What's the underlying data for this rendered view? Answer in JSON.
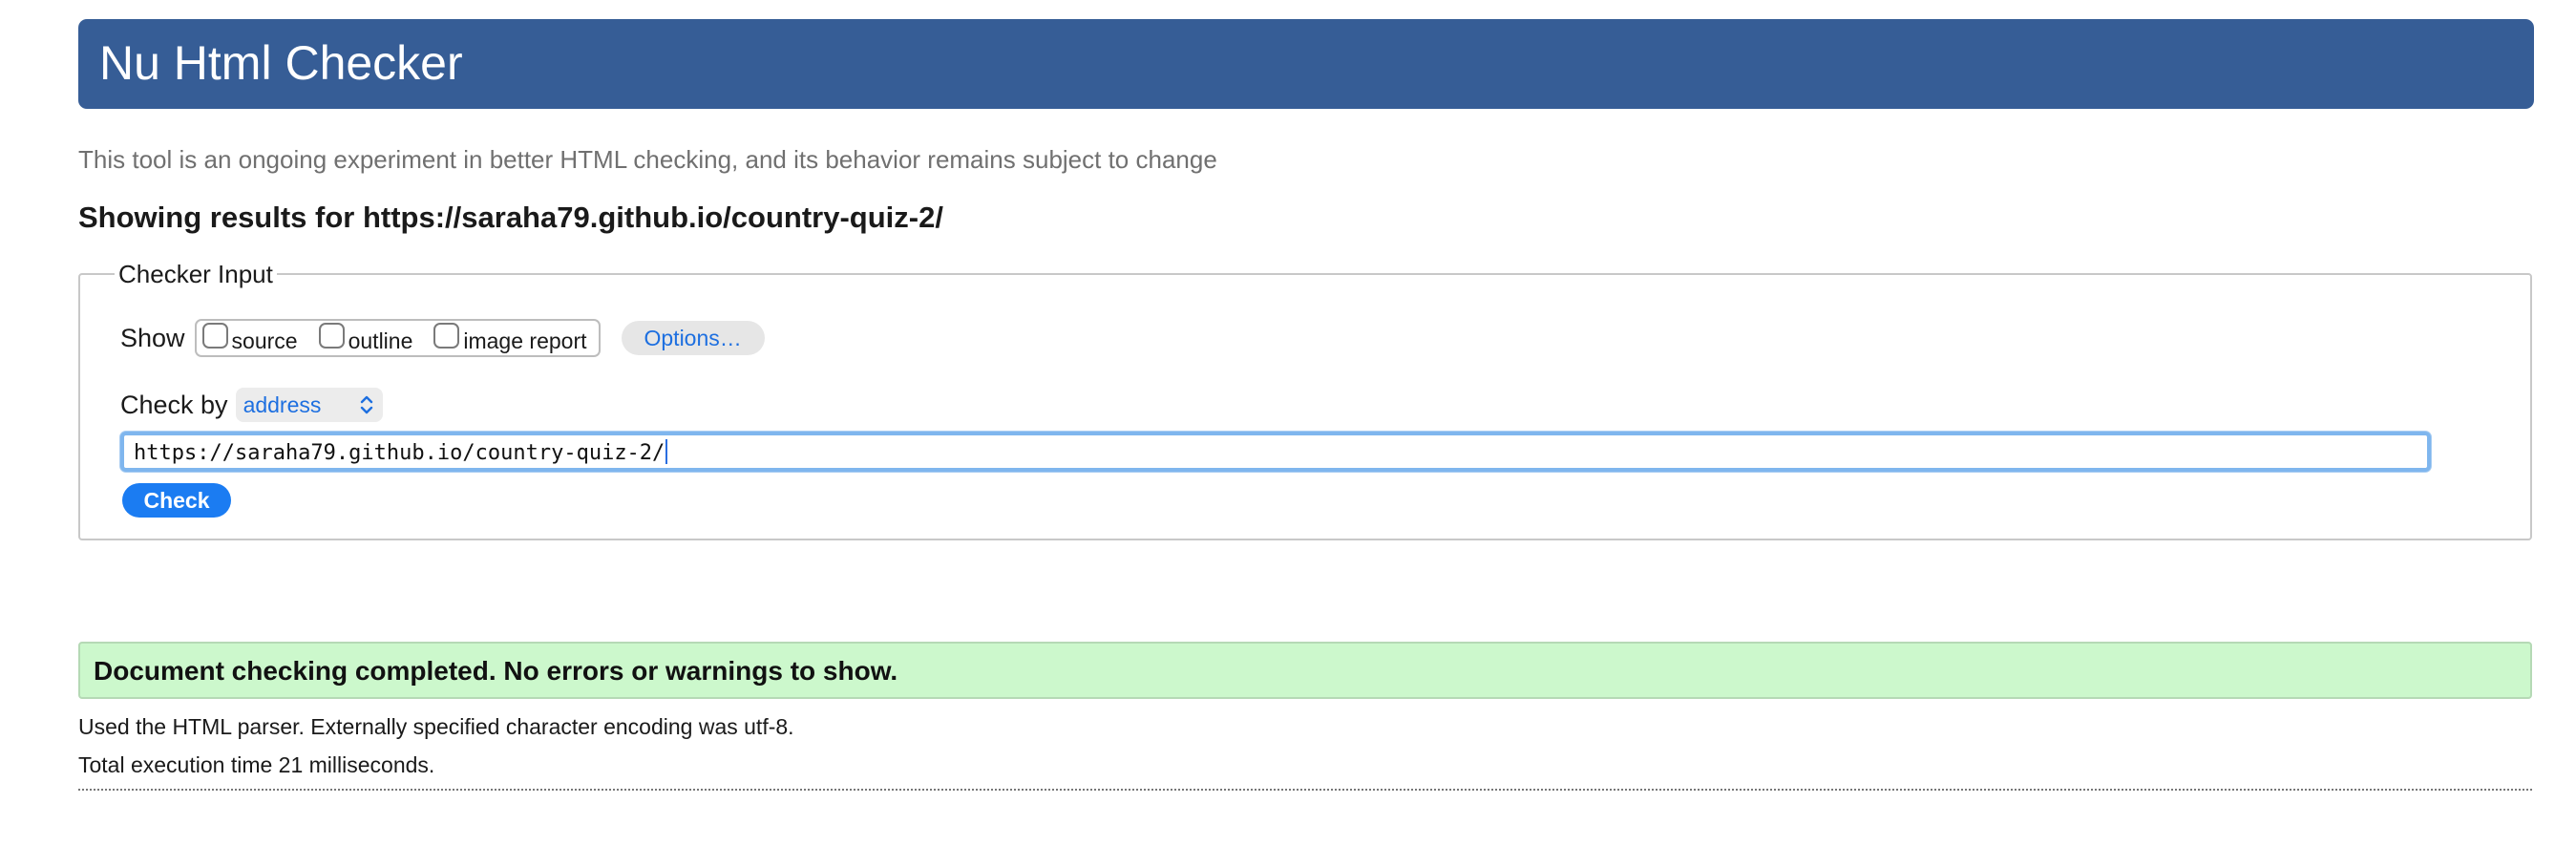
{
  "header": {
    "title": "Nu Html Checker",
    "background": "#365d96"
  },
  "tagline": "This tool is an ongoing experiment in better HTML checking, and its behavior remains subject to change",
  "results_heading": "Showing results for https://saraha79.github.io/country-quiz-2/",
  "checker_input": {
    "legend": "Checker Input",
    "show_label": "Show",
    "checkboxes": [
      {
        "label": "source",
        "checked": false
      },
      {
        "label": "outline",
        "checked": false
      },
      {
        "label": "image report",
        "checked": false
      }
    ],
    "options_label": "Options…",
    "check_by_label": "Check by",
    "check_by_value": "address",
    "url_value": "https://saraha79.github.io/country-quiz-2/",
    "check_button_label": "Check"
  },
  "result": {
    "message": "Document checking completed. No errors or warnings to show.",
    "background": "#ccf8cc",
    "parser_info": "Used the HTML parser. Externally specified character encoding was utf-8.",
    "execution_time": "Total execution time 21 milliseconds."
  },
  "icons": {
    "select_arrow": "chevron-up-down-icon"
  }
}
